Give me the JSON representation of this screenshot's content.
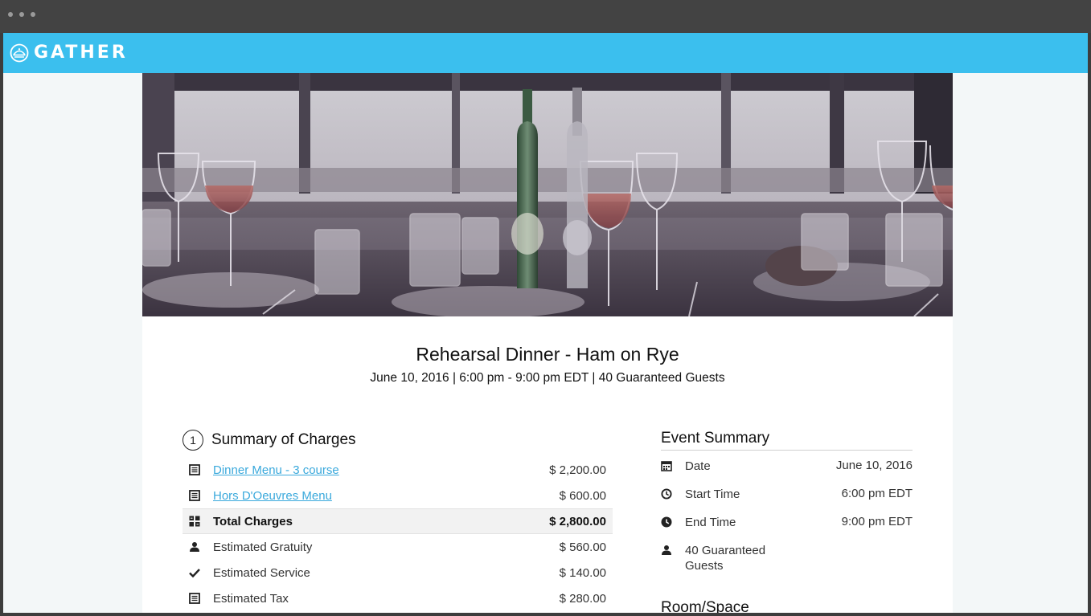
{
  "app": {
    "logo_text": "GATHER",
    "accent_color": "#3bbfee"
  },
  "event": {
    "title": "Rehearsal Dinner - Ham on Rye",
    "subtitle": "June 10, 2016 | 6:00 pm - 9:00 pm EDT | 40 Guaranteed Guests"
  },
  "charges": {
    "step": "1",
    "title": "Summary of Charges",
    "rows": [
      {
        "icon": "document-icon",
        "label": "Dinner Menu - 3 course",
        "amount": "$ 2,200.00",
        "link": true
      },
      {
        "icon": "document-icon",
        "label": "Hors D'Oeuvres Menu",
        "amount": "$ 600.00",
        "link": true
      },
      {
        "icon": "total-charges-icon",
        "label": "Total Charges",
        "amount": "$ 2,800.00",
        "total": true
      },
      {
        "icon": "person-icon",
        "label": "Estimated Gratuity",
        "amount": "$ 560.00"
      },
      {
        "icon": "checkmark-icon",
        "label": "Estimated Service",
        "amount": "$ 140.00"
      },
      {
        "icon": "document-icon",
        "label": "Estimated Tax",
        "amount": "$ 280.00"
      }
    ]
  },
  "summary": {
    "title": "Event Summary",
    "rows": [
      {
        "icon": "calendar-icon",
        "label": "Date",
        "value": "June 10, 2016"
      },
      {
        "icon": "clock-outline-icon",
        "label": "Start Time",
        "value": "6:00 pm EDT"
      },
      {
        "icon": "clock-filled-icon",
        "label": "End Time",
        "value": "9:00 pm EDT"
      },
      {
        "icon": "person-icon",
        "label": "40 Guaranteed Guests",
        "value": ""
      }
    ],
    "room_title": "Room/Space"
  }
}
